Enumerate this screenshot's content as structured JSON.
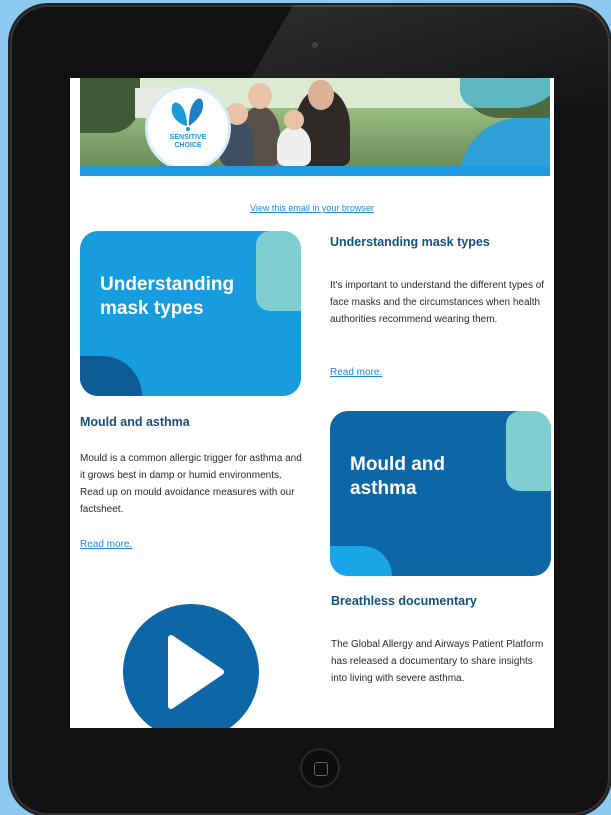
{
  "email": {
    "logo_text": "SENSITIVE\nCHOICE",
    "view_in_browser": "View this email in your browser",
    "articles": [
      {
        "card_title": "Understanding\nmask types",
        "heading": "Understanding mask types",
        "body": "It's important to understand the different types of face masks and the circumstances when health authorities recommend wearing them.",
        "read_more": "Read more."
      },
      {
        "card_title": "Mould and\nasthma",
        "heading": "Mould and asthma",
        "body": "Mould is a common allergic trigger for asthma and it grows best in damp or humid environments. Read up on mould avoidance measures with our factsheet.",
        "read_more": "Read more."
      },
      {
        "heading": "Breathless documentary",
        "body": "The Global Allergy and Airways Patient Platform has released a documentary to share insights into living with severe asthma."
      }
    ]
  },
  "colors": {
    "background": "#8ec9ef",
    "brand_blue": "#179cde",
    "dark_blue": "#0d66a6",
    "teal": "#7fcfd2",
    "heading": "#15507e",
    "link": "#1e88d8"
  },
  "icons": [
    "butterfly-logo-icon",
    "play-icon",
    "home-button-icon"
  ]
}
